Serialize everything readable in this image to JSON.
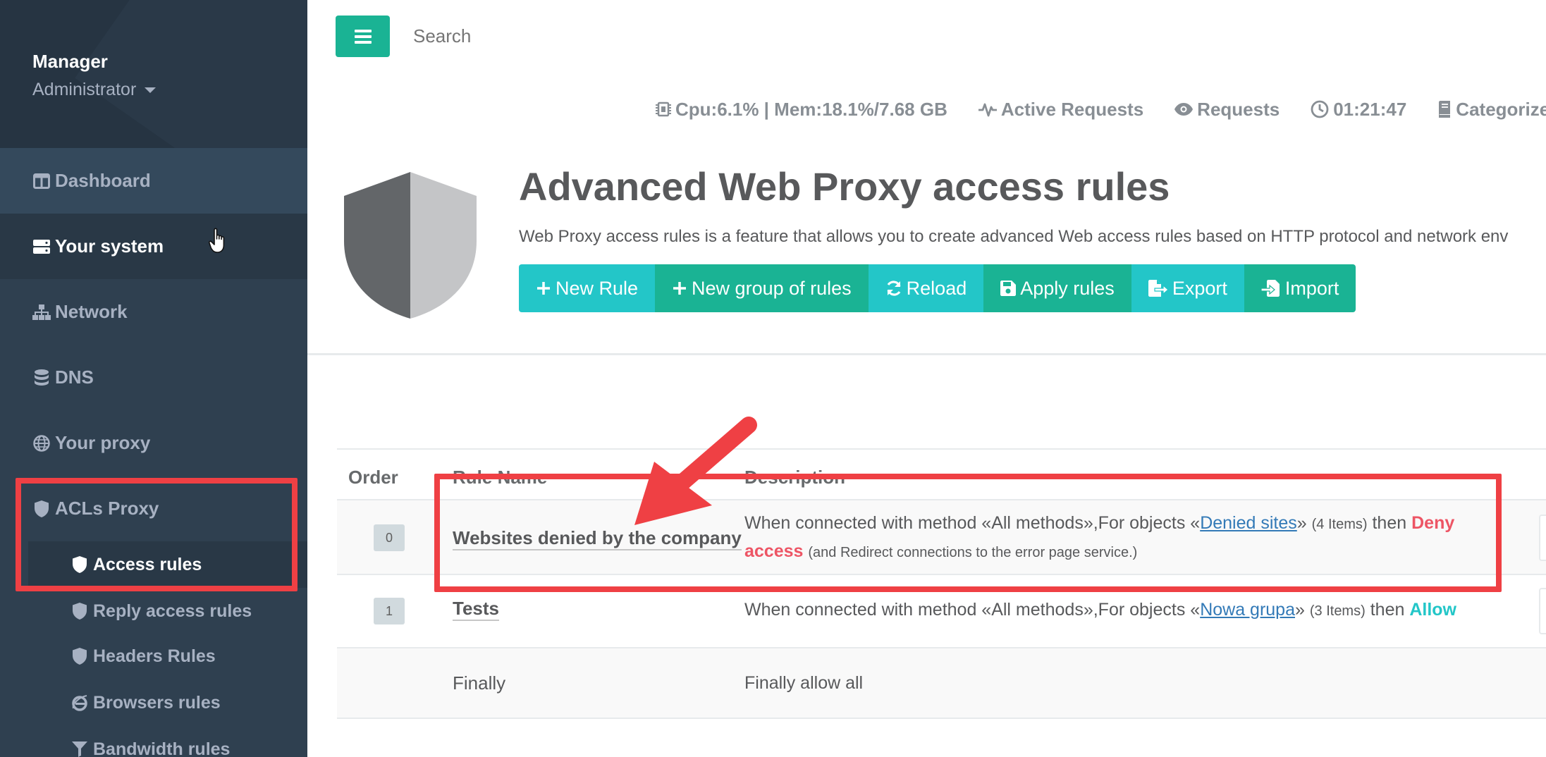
{
  "user": {
    "name": "Manager",
    "role": "Administrator"
  },
  "sidebar": {
    "items": [
      {
        "label": "Dashboard"
      },
      {
        "label": "Your system"
      },
      {
        "label": "Network"
      },
      {
        "label": "DNS"
      },
      {
        "label": "Your proxy"
      },
      {
        "label": "ACLs Proxy"
      }
    ],
    "subitems": [
      {
        "label": "Access rules"
      },
      {
        "label": "Reply access rules"
      },
      {
        "label": "Headers Rules"
      },
      {
        "label": "Browsers rules"
      },
      {
        "label": "Bandwidth rules"
      }
    ]
  },
  "topbar": {
    "search_placeholder": "Search",
    "stats": {
      "cpu_mem": "Cpu:6.1% | Mem:18.1%/7.68 GB",
      "active_requests": "Active Requests",
      "requests": "Requests",
      "time": "01:21:47",
      "categorize": "Categorize"
    }
  },
  "page": {
    "title": "Advanced Web Proxy access rules",
    "subtitle": "Web Proxy access rules is a feature that allows you to create advanced Web access rules based on HTTP protocol and network env",
    "buttons": {
      "new_rule": "New Rule",
      "new_group": "New group of rules",
      "reload": "Reload",
      "apply": "Apply rules",
      "export": "Export",
      "import": "Import"
    }
  },
  "table": {
    "headers": {
      "order": "Order",
      "rule_name": "Rule Name",
      "description": "Description"
    },
    "rows": [
      {
        "order": "0",
        "name": "Websites denied by the company",
        "desc_prefix": "When connected with method «All methods»,For objects «",
        "desc_link": "Denied sites",
        "desc_mid_close": "»",
        "desc_count": "(4 Items)",
        "desc_then": "then",
        "desc_action": "Deny access",
        "desc_action_1": "Deny",
        "desc_action_2": "access",
        "desc_note": "(and Redirect connections to the error page service.)"
      },
      {
        "order": "1",
        "name": "Tests",
        "desc_prefix": "When connected with method «All methods»,For objects «",
        "desc_link": "Nowa grupa",
        "desc_mid_close": "»",
        "desc_count": "(3 Items)",
        "desc_then": "then",
        "desc_action": "Allow"
      },
      {
        "name": "Finally",
        "description": "Finally allow all"
      }
    ]
  },
  "colors": {
    "sidebar": "#2f4050",
    "accent_green": "#1ab394",
    "accent_cyan": "#23c6c8",
    "annotation_red": "#ef4044",
    "deny_red": "#ed5565"
  }
}
